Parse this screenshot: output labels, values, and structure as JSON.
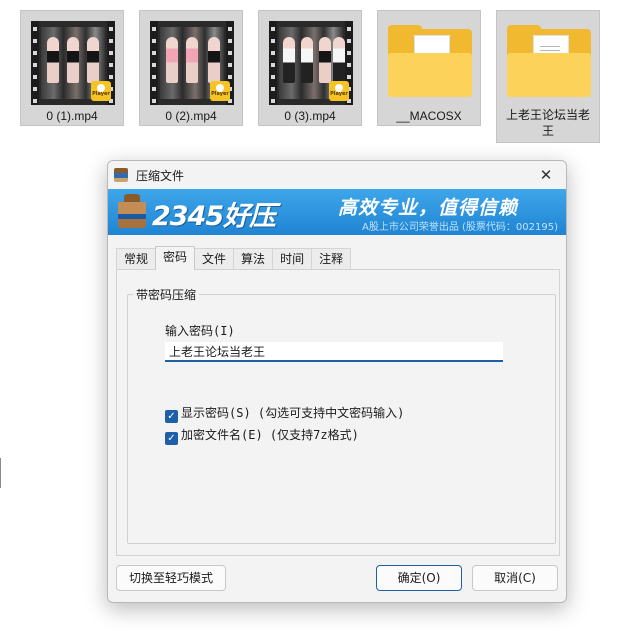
{
  "files": [
    {
      "name": "0 (1).mp4",
      "type": "video",
      "badge": "Player"
    },
    {
      "name": "0 (2).mp4",
      "type": "video",
      "badge": "Player"
    },
    {
      "name": "0 (3).mp4",
      "type": "video",
      "badge": "Player"
    },
    {
      "name": "__MACOSX",
      "type": "folder"
    },
    {
      "name": "上老王论坛当老王",
      "type": "folder"
    }
  ],
  "dialog": {
    "title": "压缩文件",
    "close_glyph": "✕",
    "banner": {
      "brand": "2345好压",
      "slogan": "高效专业，值得信赖",
      "stock_info": "A股上市公司荣誉出品 (股票代码：002195)"
    },
    "tabs": [
      "常规",
      "密码",
      "文件",
      "算法",
      "时间",
      "注释"
    ],
    "active_tab": "密码",
    "group_title": "带密码压缩",
    "password_label": "输入密码(I)",
    "password_value": "上老王论坛当老王",
    "show_password": {
      "label": "显示密码(S) (勾选可支持中文密码输入)",
      "checked": true
    },
    "encrypt_filenames": {
      "label": "加密文件名(E) (仅支持7z格式)",
      "checked": true
    },
    "buttons": {
      "switch_mode": "切换至轻巧模式",
      "ok": "确定(O)",
      "cancel": "取消(C)"
    }
  },
  "colors": {
    "banner": "#1f84d3",
    "accent": "#1f5fa8",
    "folder": "#f1b92f",
    "player_badge": "#f6c324"
  }
}
